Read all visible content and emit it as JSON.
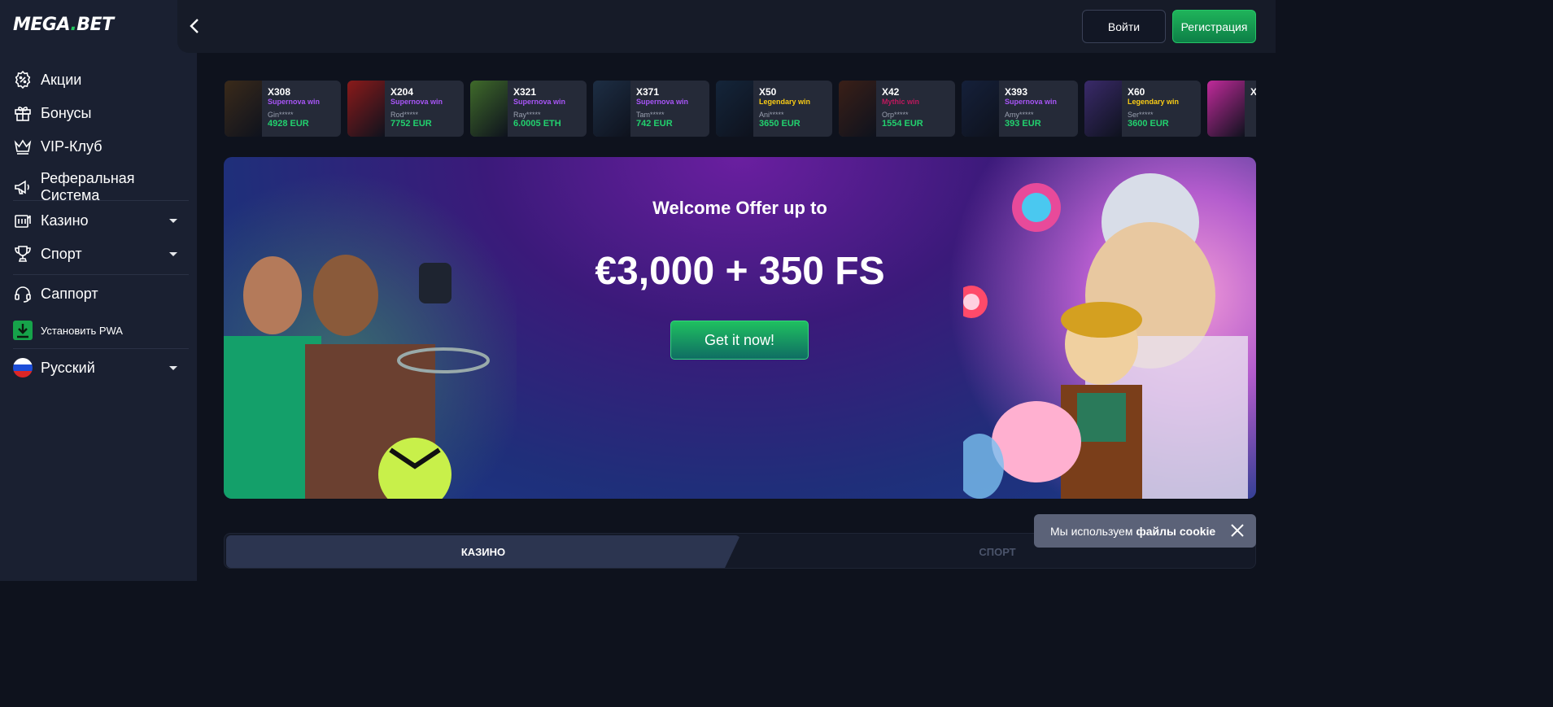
{
  "brand": {
    "mega": "MEGA",
    "dot": ".",
    "bet": "BET"
  },
  "sidebar": {
    "items": [
      {
        "label": "Акции",
        "icon": "promo-icon"
      },
      {
        "label": "Бонусы",
        "icon": "gift-icon"
      },
      {
        "label": "VIP-Клуб",
        "icon": "crown-icon"
      },
      {
        "label": "Реферальная Система",
        "icon": "megaphone-icon"
      },
      {
        "label": "Казино",
        "icon": "casino-icon"
      },
      {
        "label": "Спорт",
        "icon": "trophy-icon"
      },
      {
        "label": "Саппорт",
        "icon": "headset-icon"
      },
      {
        "label": "Установить PWA",
        "icon": "download-icon"
      },
      {
        "label": "Русский",
        "icon": "flag-icon"
      }
    ]
  },
  "header": {
    "login": "Войти",
    "register": "Регистрация"
  },
  "wins": [
    {
      "mult": "X308",
      "type": "Supernova win",
      "user": "Gin*****",
      "amount": "4928 EUR",
      "color": "#a855f7",
      "thumb": "#3a2a1a"
    },
    {
      "mult": "X204",
      "type": "Supernova win",
      "user": "Rod*****",
      "amount": "7752 EUR",
      "color": "#a855f7",
      "thumb": "#8a1a1a"
    },
    {
      "mult": "X321",
      "type": "Supernova win",
      "user": "Ray*****",
      "amount": "6.0005 ETH",
      "color": "#a855f7",
      "thumb": "#3f6a2a"
    },
    {
      "mult": "X371",
      "type": "Supernova win",
      "user": "Tam*****",
      "amount": "742 EUR",
      "color": "#a855f7",
      "thumb": "#1d2e44"
    },
    {
      "mult": "X50",
      "type": "Legendary win",
      "user": "Ani*****",
      "amount": "3650 EUR",
      "color": "#facc15",
      "thumb": "#14253a"
    },
    {
      "mult": "X42",
      "type": "Mythic win",
      "user": "Orp*****",
      "amount": "1554 EUR",
      "color": "#be185d",
      "thumb": "#3a1f17"
    },
    {
      "mult": "X393",
      "type": "Supernova win",
      "user": "Amy*****",
      "amount": "393 EUR",
      "color": "#a855f7",
      "thumb": "#15203a"
    },
    {
      "mult": "X60",
      "type": "Legendary win",
      "user": "Ser*****",
      "amount": "3600 EUR",
      "color": "#facc15",
      "thumb": "#3a2a6a"
    },
    {
      "mult": "X",
      "type": "",
      "user": "",
      "amount": "",
      "color": "#a855f7",
      "thumb": "#c02a9a"
    }
  ],
  "banner": {
    "welcome": "Welcome Offer up to",
    "amount": "€3,000 + 350 FS",
    "cta": "Get it now!"
  },
  "tabs": {
    "casino": "КАЗИНО",
    "sport": "СПОРТ"
  },
  "cookie": {
    "text": "Мы используем",
    "bold": "файлы cookie"
  }
}
